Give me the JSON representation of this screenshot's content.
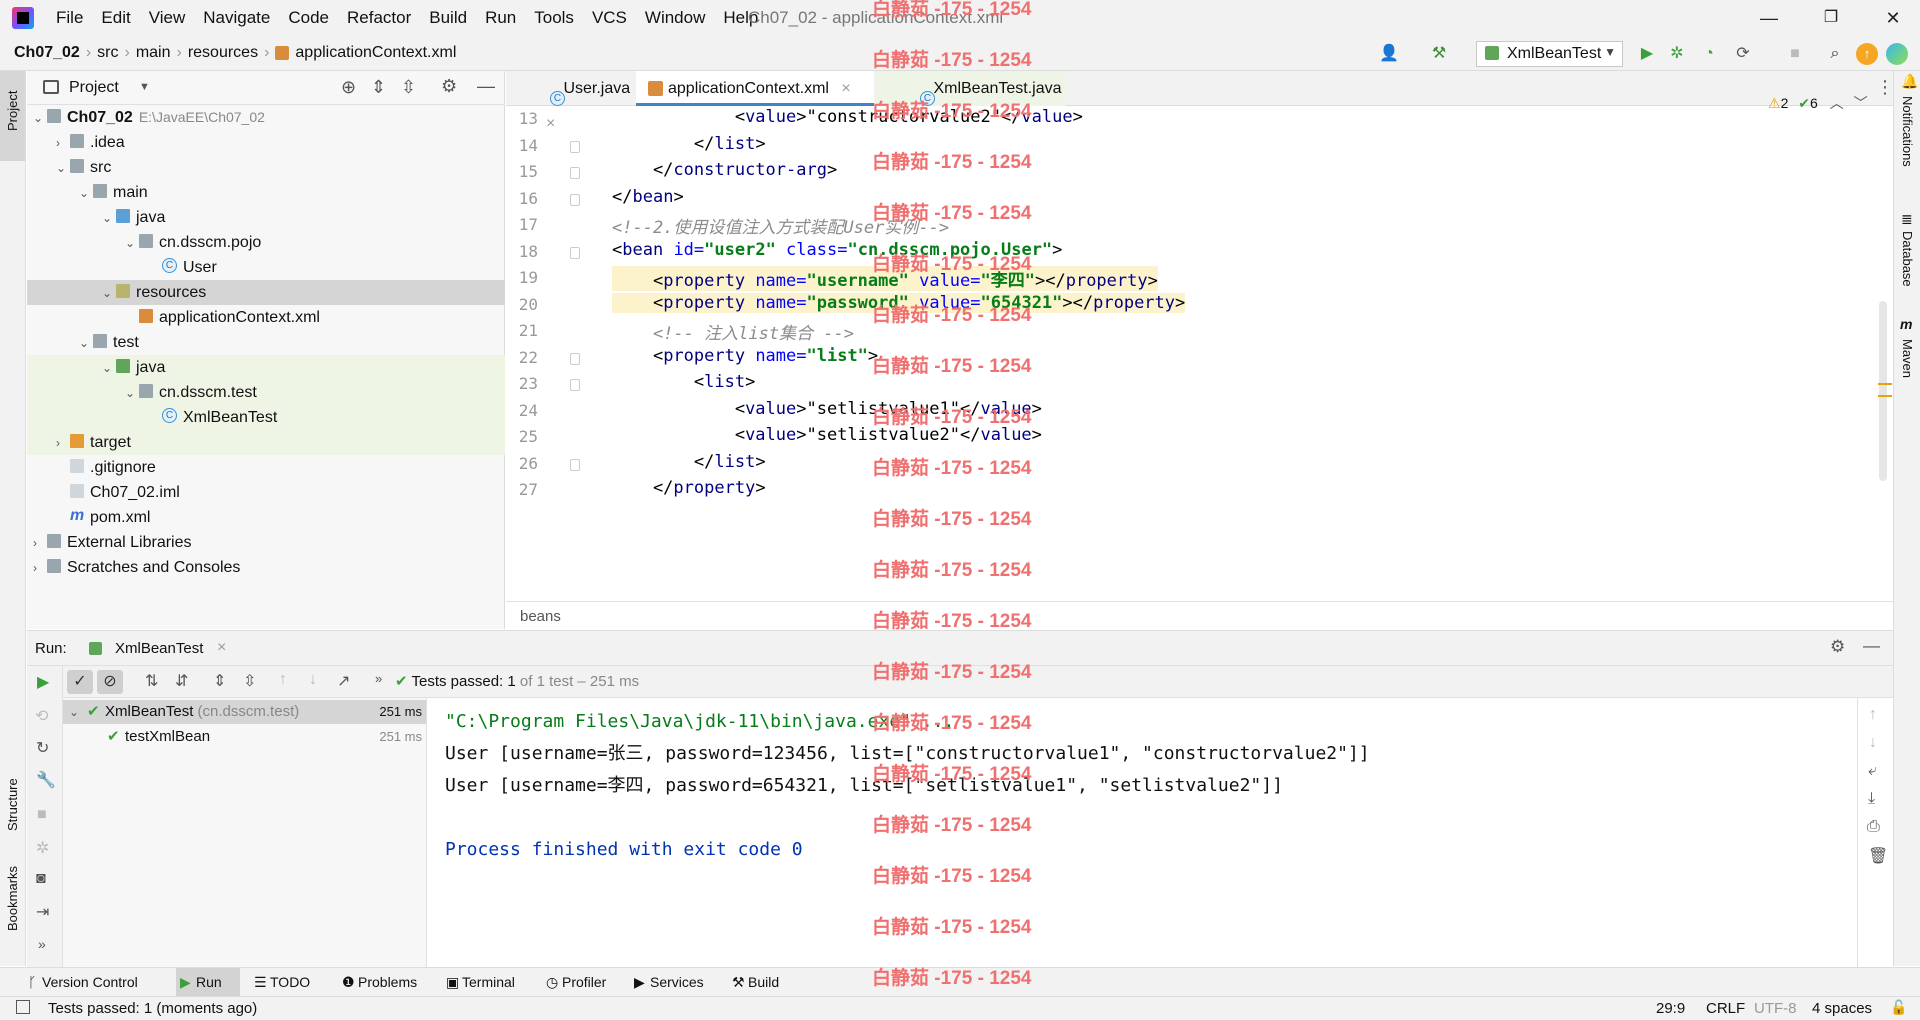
{
  "menubar": {
    "items": [
      "File",
      "Edit",
      "View",
      "Navigate",
      "Code",
      "Refactor",
      "Build",
      "Run",
      "Tools",
      "VCS",
      "Window",
      "Help"
    ],
    "window_title": "Ch07_02 - applicationContext.xml"
  },
  "navbar": {
    "crumbs": [
      "Ch07_02",
      "src",
      "main",
      "resources",
      "applicationContext.xml"
    ],
    "run_config": "XmlBeanTest"
  },
  "project": {
    "title": "Project",
    "tree": [
      {
        "label": "Ch07_02",
        "path": "E:\\JavaEE\\Ch07_02",
        "level": 0,
        "icon": "module-folder-icon",
        "bold": true,
        "arrow": "⌄"
      },
      {
        "label": ".idea",
        "level": 1,
        "icon": "folder-icon",
        "arrow": "›"
      },
      {
        "label": "src",
        "level": 1,
        "icon": "folder-icon",
        "arrow": "⌄"
      },
      {
        "label": "main",
        "level": 2,
        "icon": "folder-icon",
        "arrow": "⌄"
      },
      {
        "label": "java",
        "level": 3,
        "icon": "source-folder-icon",
        "arrow": "⌄"
      },
      {
        "label": "cn.dsscm.pojo",
        "level": 4,
        "icon": "package-icon",
        "arrow": "⌄"
      },
      {
        "label": "User",
        "level": 5,
        "icon": "class-icon",
        "arrow": ""
      },
      {
        "label": "resources",
        "level": 3,
        "icon": "resources-folder-icon",
        "arrow": "⌄",
        "selected": true
      },
      {
        "label": "applicationContext.xml",
        "level": 4,
        "icon": "xml-file-icon",
        "arrow": ""
      },
      {
        "label": "test",
        "level": 2,
        "icon": "folder-icon",
        "arrow": "⌄"
      },
      {
        "label": "java",
        "level": 3,
        "icon": "test-folder-icon",
        "arrow": "⌄",
        "test": true
      },
      {
        "label": "cn.dsscm.test",
        "level": 4,
        "icon": "package-icon",
        "arrow": "⌄",
        "test": true
      },
      {
        "label": "XmlBeanTest",
        "level": 5,
        "icon": "test-class-icon",
        "arrow": "",
        "test": true
      },
      {
        "label": "target",
        "level": 1,
        "icon": "excluded-folder-icon",
        "arrow": "›",
        "test": true
      },
      {
        "label": ".gitignore",
        "level": 1,
        "icon": "gitignore-icon",
        "arrow": ""
      },
      {
        "label": "Ch07_02.iml",
        "level": 1,
        "icon": "iml-file-icon",
        "arrow": ""
      },
      {
        "label": "pom.xml",
        "level": 1,
        "icon": "maven-file-icon",
        "arrow": ""
      },
      {
        "label": "External Libraries",
        "level": 0,
        "icon": "libraries-icon",
        "arrow": "›"
      },
      {
        "label": "Scratches and Consoles",
        "level": 0,
        "icon": "scratches-icon",
        "arrow": "›"
      }
    ]
  },
  "editor": {
    "tabs": [
      "User.java",
      "applicationContext.xml",
      "XmlBeanTest.java"
    ],
    "inspection": {
      "warnings": "2",
      "checks": "6"
    },
    "lines": [
      {
        "n": "13",
        "parts": [
          [
            "t",
            "            <"
          ],
          [
            "tag",
            "value"
          ],
          [
            "t",
            ">\"constructorvalue2\"</"
          ],
          [
            "tag",
            "value"
          ],
          [
            "t",
            ">"
          ]
        ],
        "hl": false
      },
      {
        "n": "14",
        "parts": [
          [
            "t",
            "        </"
          ],
          [
            "tag",
            "list"
          ],
          [
            "t",
            ">"
          ]
        ],
        "hl": false
      },
      {
        "n": "15",
        "parts": [
          [
            "t",
            "    </"
          ],
          [
            "tag",
            "constructor-arg"
          ],
          [
            "t",
            ">"
          ]
        ],
        "hl": false
      },
      {
        "n": "16",
        "parts": [
          [
            "t",
            "</"
          ],
          [
            "tag",
            "bean"
          ],
          [
            "t",
            ">"
          ]
        ],
        "hl": false
      },
      {
        "n": "17",
        "parts": [
          [
            "cm",
            "<!--2.使用设值注入方式装配User实例-->"
          ]
        ],
        "hl": false
      },
      {
        "n": "18",
        "parts": [
          [
            "t",
            "<"
          ],
          [
            "tag",
            "bean "
          ],
          [
            "an",
            "id="
          ],
          [
            "av",
            "\"user2\" "
          ],
          [
            "an",
            "class="
          ],
          [
            "av",
            "\"cn.dsscm.pojo.User\""
          ],
          [
            "t",
            ">"
          ]
        ],
        "hl": false
      },
      {
        "n": "19",
        "parts": [
          [
            "t",
            "    <"
          ],
          [
            "tag",
            "property "
          ],
          [
            "an",
            "name="
          ],
          [
            "av",
            "\"username\" "
          ],
          [
            "an",
            "value="
          ],
          [
            "av",
            "\"李四\""
          ],
          [
            "t",
            "></"
          ],
          [
            "tag",
            "property"
          ],
          [
            "t",
            ">"
          ]
        ],
        "hl": true
      },
      {
        "n": "20",
        "parts": [
          [
            "t",
            "    <"
          ],
          [
            "tag",
            "property "
          ],
          [
            "an",
            "name="
          ],
          [
            "av",
            "\"password\" "
          ],
          [
            "an",
            "value="
          ],
          [
            "av",
            "\"654321\""
          ],
          [
            "t",
            "></"
          ],
          [
            "tag",
            "property"
          ],
          [
            "t",
            ">"
          ]
        ],
        "hl": true
      },
      {
        "n": "21",
        "parts": [
          [
            "cm",
            "    <!-- 注入list集合 -->"
          ]
        ],
        "hl": false
      },
      {
        "n": "22",
        "parts": [
          [
            "t",
            "    <"
          ],
          [
            "tag",
            "property "
          ],
          [
            "an",
            "name="
          ],
          [
            "av",
            "\"list\""
          ],
          [
            "t",
            ">"
          ]
        ],
        "hl": false
      },
      {
        "n": "23",
        "parts": [
          [
            "t",
            "        <"
          ],
          [
            "tag",
            "list"
          ],
          [
            "t",
            ">"
          ]
        ],
        "hl": false
      },
      {
        "n": "24",
        "parts": [
          [
            "t",
            "            <"
          ],
          [
            "tag",
            "value"
          ],
          [
            "t",
            ">\"setlistvalue1\"</"
          ],
          [
            "tag",
            "value"
          ],
          [
            "t",
            ">"
          ]
        ],
        "hl": false
      },
      {
        "n": "25",
        "parts": [
          [
            "t",
            "            <"
          ],
          [
            "tag",
            "value"
          ],
          [
            "t",
            ">\"setlistvalue2\"</"
          ],
          [
            "tag",
            "value"
          ],
          [
            "t",
            ">"
          ]
        ],
        "hl": false
      },
      {
        "n": "26",
        "parts": [
          [
            "t",
            "        </"
          ],
          [
            "tag",
            "list"
          ],
          [
            "t",
            ">"
          ]
        ],
        "hl": false
      },
      {
        "n": "27",
        "parts": [
          [
            "t",
            "    </"
          ],
          [
            "tag",
            "property"
          ],
          [
            "t",
            ">"
          ]
        ],
        "hl": false
      }
    ],
    "breadcrumb": "beans"
  },
  "run": {
    "label": "Run:",
    "tab": "XmlBeanTest",
    "tests_passed_label": "Tests passed:",
    "tests_passed_count": "1",
    "tests_passed_rest": "of 1 test – 251 ms",
    "tree": [
      {
        "name": "XmlBeanTest",
        "pkg": "(cn.dsscm.test)",
        "time": "251 ms"
      },
      {
        "name": "testXmlBean",
        "pkg": "",
        "time": "251 ms"
      }
    ],
    "console": [
      "\"C:\\Program Files\\Java\\jdk-11\\bin\\java.exe\" ...",
      "User [username=张三, password=123456, list=[\"constructorvalue1\", \"constructorvalue2\"]]",
      "User [username=李四, password=654321, list=[\"setlistvalue1\", \"setlistvalue2\"]]",
      "",
      "Process finished with exit code 0"
    ]
  },
  "bottom_tabs": [
    "Version Control",
    "Run",
    "TODO",
    "Problems",
    "Terminal",
    "Profiler",
    "Services",
    "Build"
  ],
  "status": {
    "message": "Tests passed: 1 (moments ago)",
    "position": "29:9",
    "line_sep": "CRLF",
    "encoding": "UTF-8",
    "indent": "4 spaces"
  },
  "side": {
    "left": [
      "Project",
      "Structure",
      "Bookmarks"
    ],
    "right": [
      "Notifications",
      "Database",
      "Maven"
    ]
  },
  "watermark": "白静茹 -175 - 1254",
  "colors": {
    "accent": "#4083c9",
    "tag": "#000080",
    "attr": "#0000ff",
    "string": "#067d17"
  }
}
